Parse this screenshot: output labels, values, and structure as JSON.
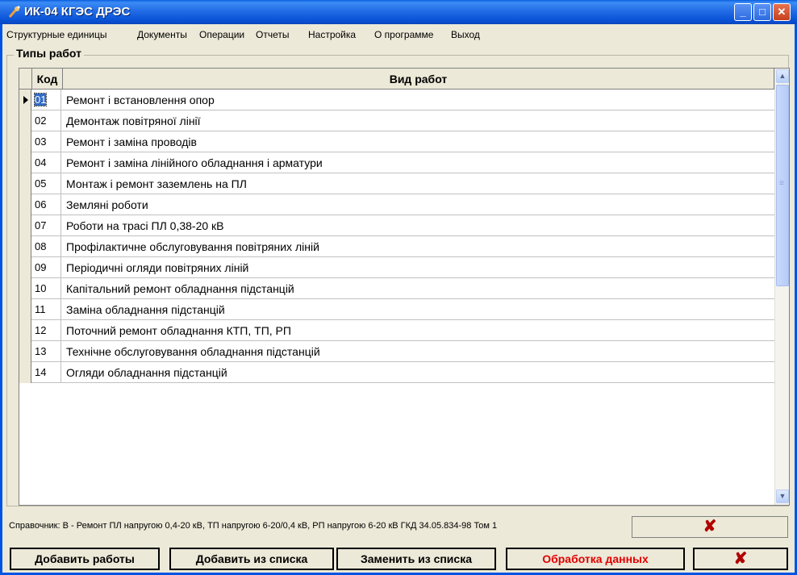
{
  "window": {
    "title": "ИК-04 КГЭС ДРЭС"
  },
  "menu": [
    "Структурные единицы",
    "Документы",
    "Операции",
    "Отчеты",
    "Настройка",
    "О программе",
    "Выход"
  ],
  "group": {
    "title": "Типы работ"
  },
  "table": {
    "columns": [
      "Код",
      "Вид работ"
    ],
    "rows": [
      {
        "code": "01",
        "name": "Ремонт і встановлення опор"
      },
      {
        "code": "02",
        "name": "Демонтаж повітряної лінії"
      },
      {
        "code": "03",
        "name": "Ремонт і заміна проводів"
      },
      {
        "code": "04",
        "name": "Ремонт і заміна лінійного обладнання і арматури"
      },
      {
        "code": "05",
        "name": "Монтаж і ремонт заземлень на ПЛ"
      },
      {
        "code": "06",
        "name": "Земляні роботи"
      },
      {
        "code": "07",
        "name": "Роботи на трасі ПЛ 0,38-20 кВ"
      },
      {
        "code": "08",
        "name": "Профілактичне обслуговування повітряних ліній"
      },
      {
        "code": "09",
        "name": "Періодичні огляди повітряних ліній"
      },
      {
        "code": "10",
        "name": "Капітальний ремонт обладнання підстанцій"
      },
      {
        "code": "11",
        "name": "Заміна обладнання підстанцій"
      },
      {
        "code": "12",
        "name": "Поточний ремонт обладнання КТП, ТП, РП"
      },
      {
        "code": "13",
        "name": "Технічне обслуговування обладнання підстанцій"
      },
      {
        "code": "14",
        "name": "Огляди обладнання підстанцій"
      }
    ],
    "selected_index": 0
  },
  "status": {
    "text": "Справочник: В - Ремонт ПЛ напругою 0,4-20 кВ, ТП напругою 6-20/0,4 кВ, РП напругою 6-20 кВ ГКД 34.05.834-98 Том 1",
    "close_glyph": "✘"
  },
  "buttons": {
    "add": "Добавить работы",
    "add_from_list": "Добавить из списка",
    "replace_from_list": "Заменить из списка",
    "process": "Обработка данных",
    "close_glyph": "✘"
  },
  "colors": {
    "accent": "#0054E3",
    "selection": "#316AC5",
    "process_text": "#E00000",
    "close_x": "#B00000"
  },
  "icons": {
    "app": "satellite-dish-icon",
    "minimize": "minimize-icon",
    "maximize": "maximize-icon",
    "close": "close-icon"
  }
}
